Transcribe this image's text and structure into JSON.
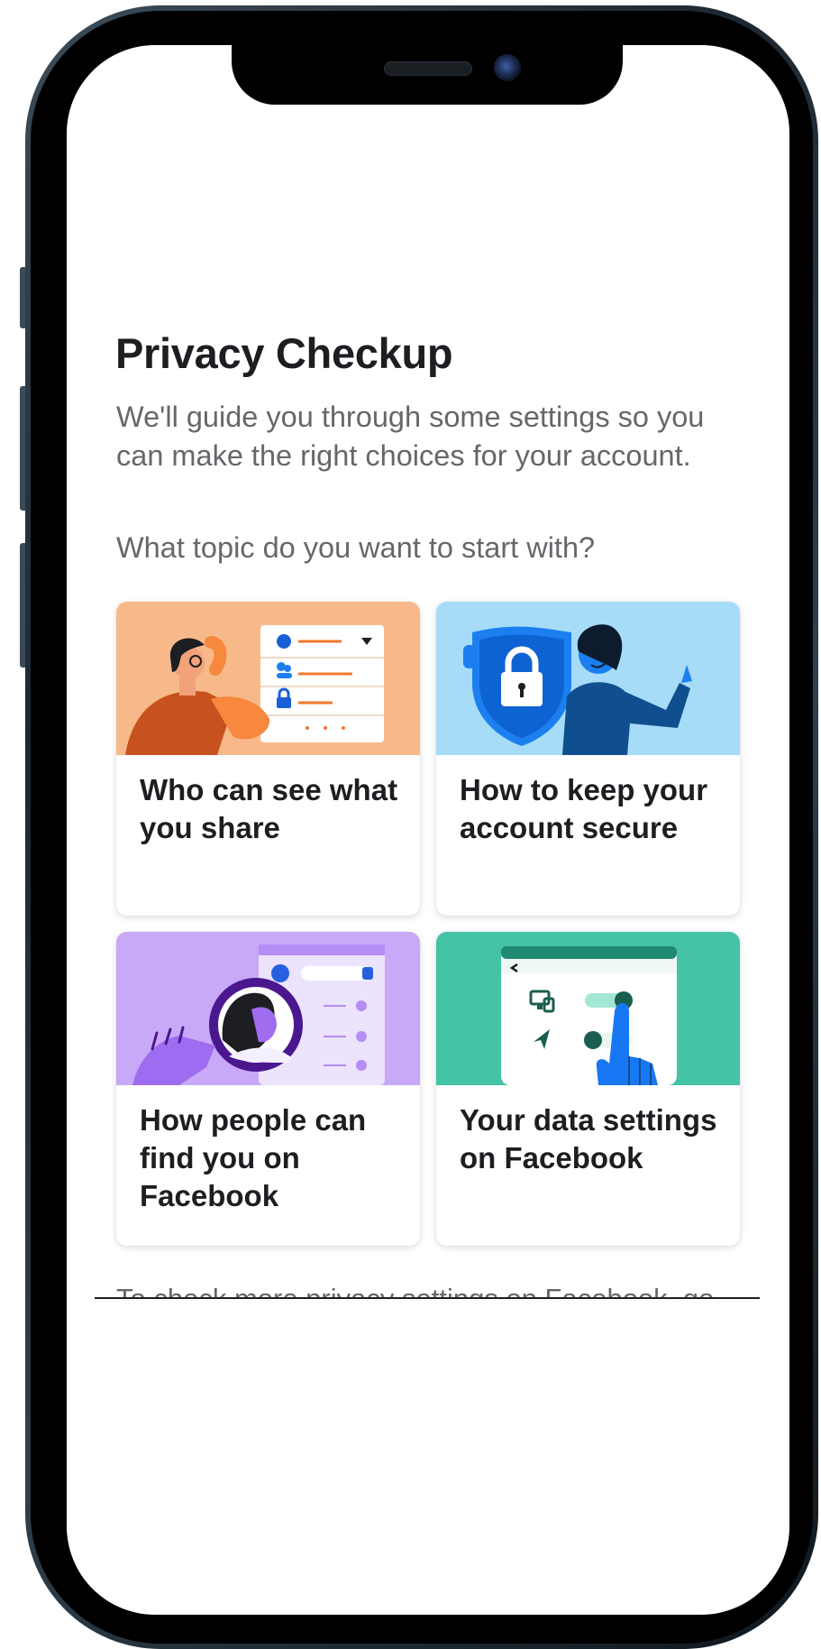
{
  "page": {
    "title": "Privacy Checkup",
    "intro": "We'll guide you through some settings so you can make the right choices for your account.",
    "question": "What topic do you want to start with?"
  },
  "topics": [
    {
      "label": "Who can see what you share",
      "art": "audience-illustration",
      "bg": "#f8b98a"
    },
    {
      "label": "How to keep your account secure",
      "art": "security-shield-illustration",
      "bg": "#a6dcf7"
    },
    {
      "label": "How people can find you on Facebook",
      "art": "magnifier-search-illustration",
      "bg": "#c7a9f7"
    },
    {
      "label": "Your data settings on Facebook",
      "art": "data-settings-illustration",
      "bg": "#45c3a6"
    }
  ],
  "footer": {
    "text": "To check more privacy settings on Facebook, go"
  },
  "colors": {
    "heading": "#1c1e21",
    "secondary_text": "#65676b",
    "card_background": "#ffffff"
  }
}
